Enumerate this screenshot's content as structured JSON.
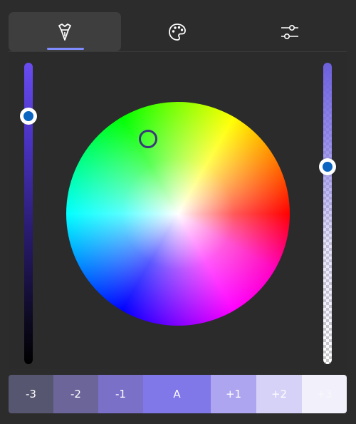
{
  "tabs": [
    {
      "name": "tab-color-wheel",
      "icon": "pen-nib-icon",
      "selected": true
    },
    {
      "name": "tab-palette",
      "icon": "palette-icon",
      "selected": false
    },
    {
      "name": "tab-sliders",
      "icon": "sliders-icon",
      "selected": false
    }
  ],
  "colors": {
    "accent": "#7f8cff",
    "selected": "#8077e8",
    "thumb": "#0a64c0"
  },
  "swatches": [
    {
      "label": "-3",
      "color": "#565670"
    },
    {
      "label": "-2",
      "color": "#6b659a"
    },
    {
      "label": "-1",
      "color": "#7b70c8"
    },
    {
      "label": "A",
      "color": "#8077e8"
    },
    {
      "label": "+1",
      "color": "#aea5f0"
    },
    {
      "label": "+2",
      "color": "#d6d2f7"
    },
    {
      "label": "+3",
      "color": "#f1f0fb"
    }
  ]
}
